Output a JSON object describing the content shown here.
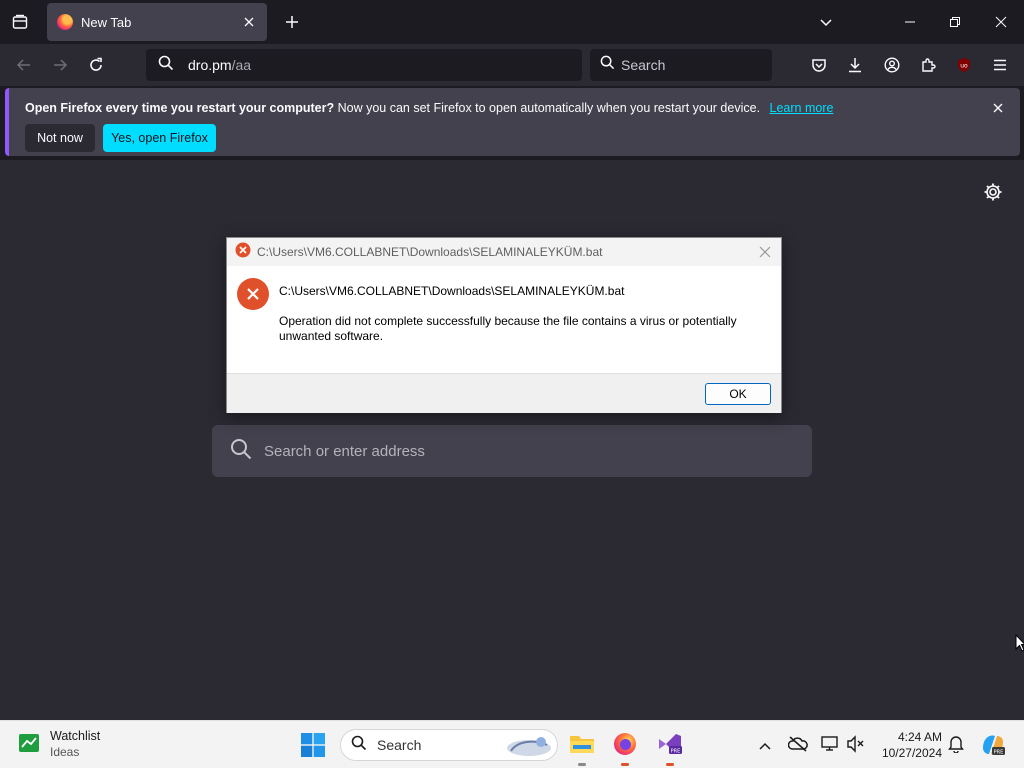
{
  "browser": {
    "tab": {
      "title": "New Tab"
    },
    "url": {
      "host": "dro.pm",
      "path": "/aa"
    },
    "search_placeholder": "Search"
  },
  "notification": {
    "bold": "Open Firefox every time you restart your computer?",
    "text": "Now you can set Firefox to open automatically when you restart your device.",
    "link": "Learn more",
    "not_now": "Not now",
    "yes": "Yes, open Firefox"
  },
  "dialog": {
    "title": "C:\\Users\\VM6.COLLABNET\\Downloads\\SELAMINALEYKÜM.bat",
    "path": "C:\\Users\\VM6.COLLABNET\\Downloads\\SELAMINALEYKÜM.bat",
    "message": "Operation did not complete successfully because the file contains a virus or potentially unwanted software.",
    "ok": "OK"
  },
  "newtab": {
    "search_placeholder": "Search or enter address"
  },
  "taskbar": {
    "widget_title": "Watchlist",
    "widget_sub": "Ideas",
    "search_placeholder": "Search",
    "time": "4:24 AM",
    "date": "10/27/2024"
  },
  "colors": {
    "accent": "#00ddff",
    "error": "#e0512b",
    "windows_blue": "#0067c0"
  }
}
